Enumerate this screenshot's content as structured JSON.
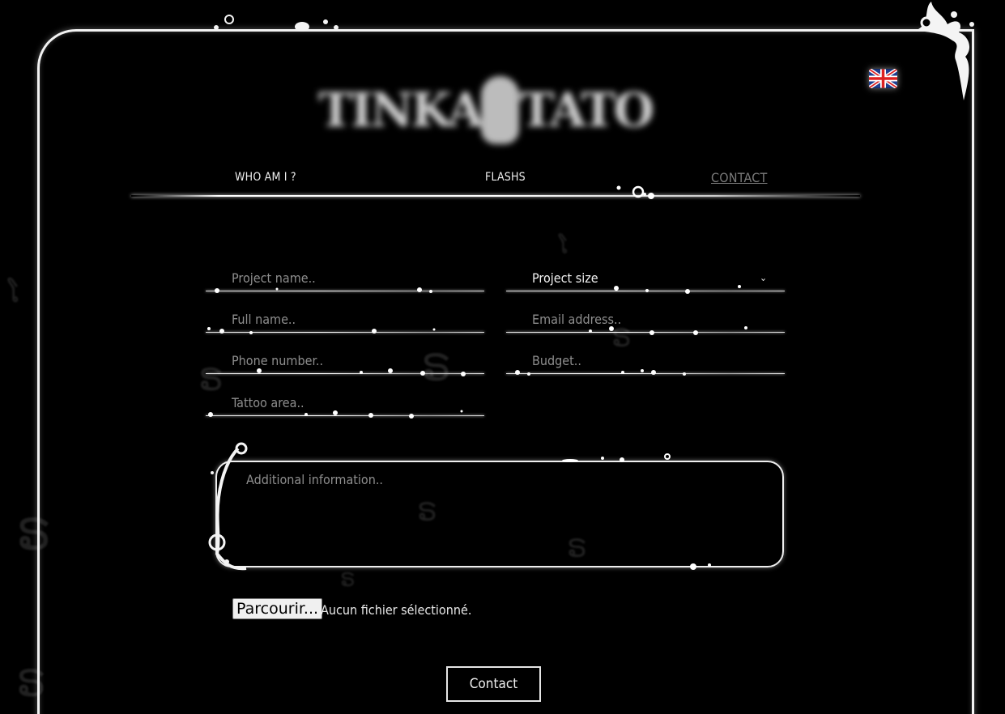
{
  "language_flag": "uk-flag-icon",
  "logo": {
    "word_left": "TINKA",
    "word_right": "TATO"
  },
  "nav": {
    "who": "WHO AM I ?",
    "flashs": "FLASHS",
    "contact": "CONTACT"
  },
  "form": {
    "project_name": "Project name..",
    "project_size": "Project size",
    "full_name": "Full name..",
    "email": "Email address..",
    "phone": "Phone number..",
    "budget": "Budget..",
    "tattoo_area": "Tattoo area..",
    "additional": "Additional information..",
    "file_button": "Parcourir...",
    "file_status": "Aucun fichier sélectionné.",
    "submit": "Contact"
  },
  "colors": {
    "background": "#000000",
    "frame": "#f2f2f2",
    "placeholder": "#8e8e8e"
  }
}
